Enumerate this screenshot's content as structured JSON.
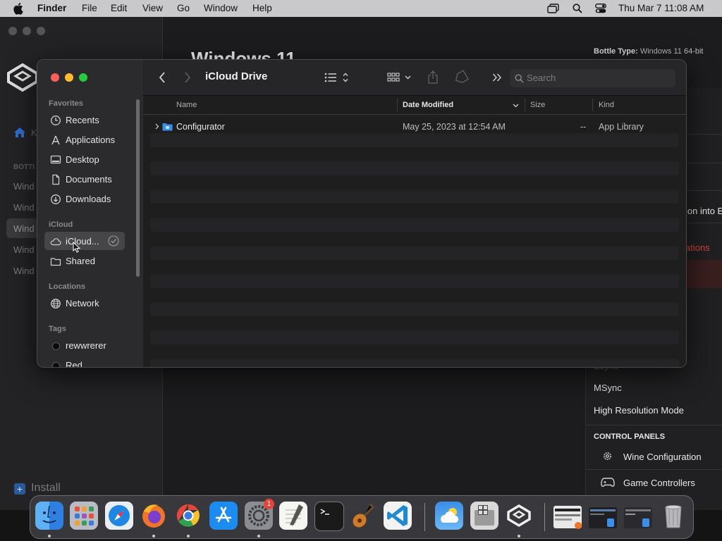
{
  "menubar": {
    "app_name": "Finder",
    "menus": [
      "File",
      "Edit",
      "View",
      "Go",
      "Window",
      "Help"
    ],
    "clock": "Thu Mar 7  11:08 AM"
  },
  "background_app": {
    "title": "Windows 11",
    "bottle_type_label": "Bottle Type:",
    "bottle_type_value": "Windows 11 64-bit",
    "sidebar_section": "BOTTI",
    "sidebar_items": [
      "Wind",
      "Wind",
      "Wind",
      "Wind",
      "Wind"
    ],
    "home_label": "K",
    "partial_rows": [
      "ion into E",
      "ations"
    ],
    "settings": [
      "Esync",
      "MSync",
      "High Resolution Mode"
    ],
    "control_panels_header": "CONTROL PANELS",
    "control_panels": [
      "Wine Configuration",
      "Game Controllers"
    ],
    "install_label": "Install"
  },
  "finder": {
    "title": "iCloud Drive",
    "search_placeholder": "Search",
    "sidebar": {
      "favorites_header": "Favorites",
      "favorites": [
        "Recents",
        "Applications",
        "Desktop",
        "Documents",
        "Downloads"
      ],
      "icloud_header": "iCloud",
      "icloud": [
        "iCloud...",
        "Shared"
      ],
      "locations_header": "Locations",
      "locations": [
        "Network"
      ],
      "tags_header": "Tags",
      "tags": [
        "rewwrerer",
        "Red"
      ]
    },
    "columns": {
      "name": "Name",
      "date": "Date Modified",
      "size": "Size",
      "kind": "Kind"
    },
    "rows": [
      {
        "name": "Configurator",
        "date": "May 25, 2023 at 12:54 AM",
        "size": "--",
        "kind": "App Library"
      }
    ]
  },
  "dock": {
    "apps": [
      "Finder",
      "Launchpad",
      "Safari",
      "Firefox",
      "Chrome",
      "App Store",
      "System Settings",
      "TextEdit",
      "Terminal",
      "GarageBand",
      "Visual Studio Code",
      "Weather",
      "Boot Camp Assistant",
      "Whisky",
      "Window 1",
      "Window 2",
      "Window 3",
      "Trash"
    ],
    "settings_badge": "1"
  },
  "colors": {
    "accent": "#2f6fd1",
    "close": "#ff5f57",
    "minimize": "#febc2e",
    "zoom": "#28c840"
  }
}
